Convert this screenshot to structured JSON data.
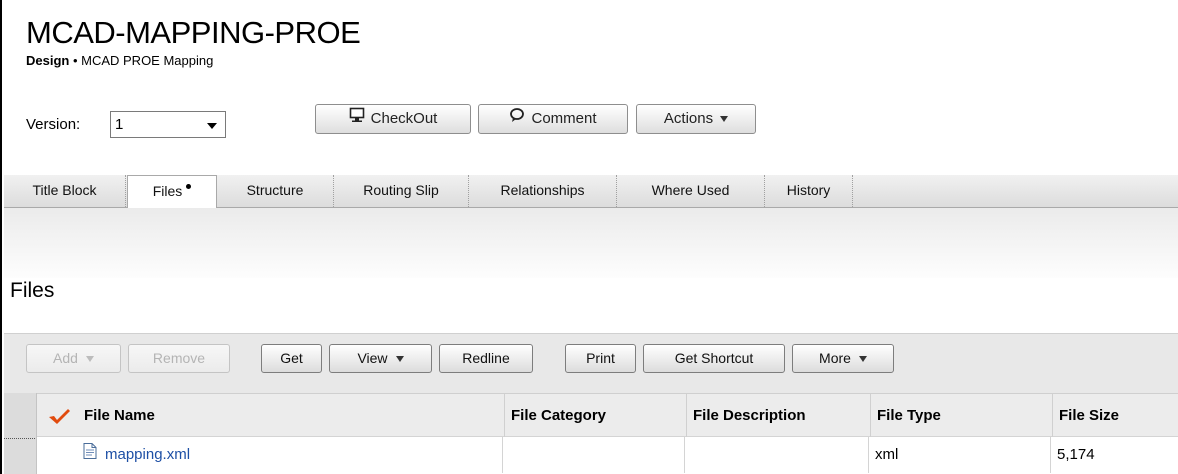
{
  "header": {
    "title": "MCAD-MAPPING-PROE",
    "subtitle_type": "Design",
    "subtitle_sep": " • ",
    "subtitle_text": "MCAD PROE Mapping"
  },
  "version": {
    "label": "Version:",
    "value": "1"
  },
  "actions": {
    "checkout": "CheckOut",
    "comment": "Comment",
    "actions": "Actions"
  },
  "tabs": [
    {
      "label": "Title Block",
      "active": false
    },
    {
      "label": "Files",
      "active": true
    },
    {
      "label": "Structure",
      "active": false
    },
    {
      "label": "Routing Slip",
      "active": false
    },
    {
      "label": "Relationships",
      "active": false
    },
    {
      "label": "Where Used",
      "active": false
    },
    {
      "label": "History",
      "active": false
    }
  ],
  "section": {
    "title": "Files"
  },
  "toolbar": {
    "add": "Add",
    "remove": "Remove",
    "get": "Get",
    "view": "View",
    "redline": "Redline",
    "print": "Print",
    "get_shortcut": "Get Shortcut",
    "more": "More"
  },
  "table": {
    "columns": [
      "File Name",
      "File Category",
      "File Description",
      "File Type",
      "File Size"
    ],
    "rows": [
      {
        "name": "mapping.xml",
        "category": "",
        "description": "",
        "type": "xml",
        "size": "5,174"
      }
    ]
  },
  "icons": {
    "checkout": "monitor-icon",
    "comment": "speech-bubble-icon",
    "header_flag": "red-check-icon",
    "file": "document-icon"
  },
  "colors": {
    "link": "#1d4fa5",
    "check": "#e14b0e"
  }
}
